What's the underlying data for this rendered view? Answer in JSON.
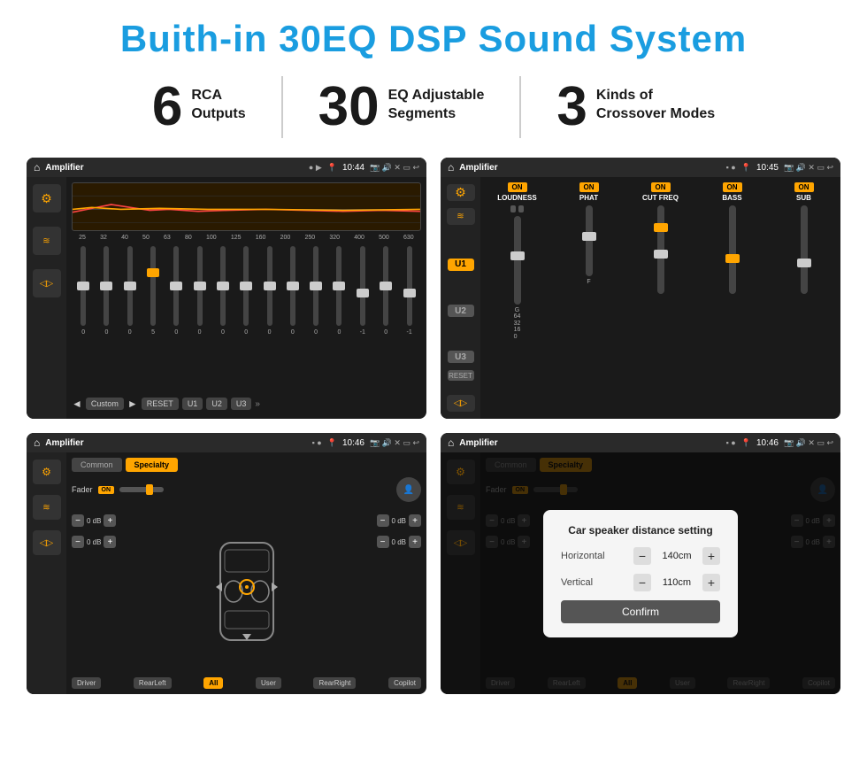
{
  "title": "Buith-in 30EQ DSP Sound System",
  "stats": [
    {
      "number": "6",
      "line1": "RCA",
      "line2": "Outputs"
    },
    {
      "number": "30",
      "line1": "EQ Adjustable",
      "line2": "Segments"
    },
    {
      "number": "3",
      "line1": "Kinds of",
      "line2": "Crossover Modes"
    }
  ],
  "screens": [
    {
      "id": "eq-screen",
      "topbar": {
        "title": "Amplifier",
        "time": "10:44"
      },
      "type": "eq"
    },
    {
      "id": "amp-screen",
      "topbar": {
        "title": "Amplifier",
        "time": "10:45"
      },
      "type": "amp"
    },
    {
      "id": "speaker-screen",
      "topbar": {
        "title": "Amplifier",
        "time": "10:46"
      },
      "type": "speaker"
    },
    {
      "id": "dialog-screen",
      "topbar": {
        "title": "Amplifier",
        "time": "10:46"
      },
      "type": "dialog"
    }
  ],
  "eq": {
    "frequencies": [
      "25",
      "32",
      "40",
      "50",
      "63",
      "80",
      "100",
      "125",
      "160",
      "200",
      "250",
      "320",
      "400",
      "500",
      "630"
    ],
    "values": [
      "0",
      "0",
      "0",
      "5",
      "0",
      "0",
      "0",
      "0",
      "0",
      "0",
      "0",
      "0",
      "-1",
      "0",
      "-1"
    ],
    "buttons": [
      "Custom",
      "RESET",
      "U1",
      "U2",
      "U3"
    ]
  },
  "amp": {
    "u_buttons": [
      "U1",
      "U2",
      "U3"
    ],
    "channels": [
      {
        "name": "LOUDNESS",
        "on": true
      },
      {
        "name": "PHAT",
        "on": true
      },
      {
        "name": "CUT FREQ",
        "on": true
      },
      {
        "name": "BASS",
        "on": true
      },
      {
        "name": "SUB",
        "on": true
      }
    ],
    "reset_label": "RESET"
  },
  "speaker": {
    "tabs": [
      "Common",
      "Specialty"
    ],
    "active_tab": "Specialty",
    "fader_label": "Fader",
    "on_label": "ON",
    "bottom_buttons": [
      "Driver",
      "RearLeft",
      "All",
      "User",
      "RearRight",
      "Copilot"
    ],
    "volumes": [
      "0 dB",
      "0 dB",
      "0 dB",
      "0 dB"
    ]
  },
  "dialog": {
    "title": "Car speaker distance setting",
    "rows": [
      {
        "label": "Horizontal",
        "value": "140cm"
      },
      {
        "label": "Vertical",
        "value": "110cm"
      }
    ],
    "confirm_label": "Confirm",
    "tabs": [
      "Common",
      "Specialty"
    ],
    "on_label": "ON",
    "bottom_buttons": [
      "Driver",
      "RearLeft",
      "All",
      "User",
      "RearRight",
      "Copilot"
    ]
  },
  "colors": {
    "accent": "#ffa500",
    "blue": "#1a9de0",
    "bg_dark": "#1a1a1a",
    "bg_medium": "#2a2a2a"
  }
}
